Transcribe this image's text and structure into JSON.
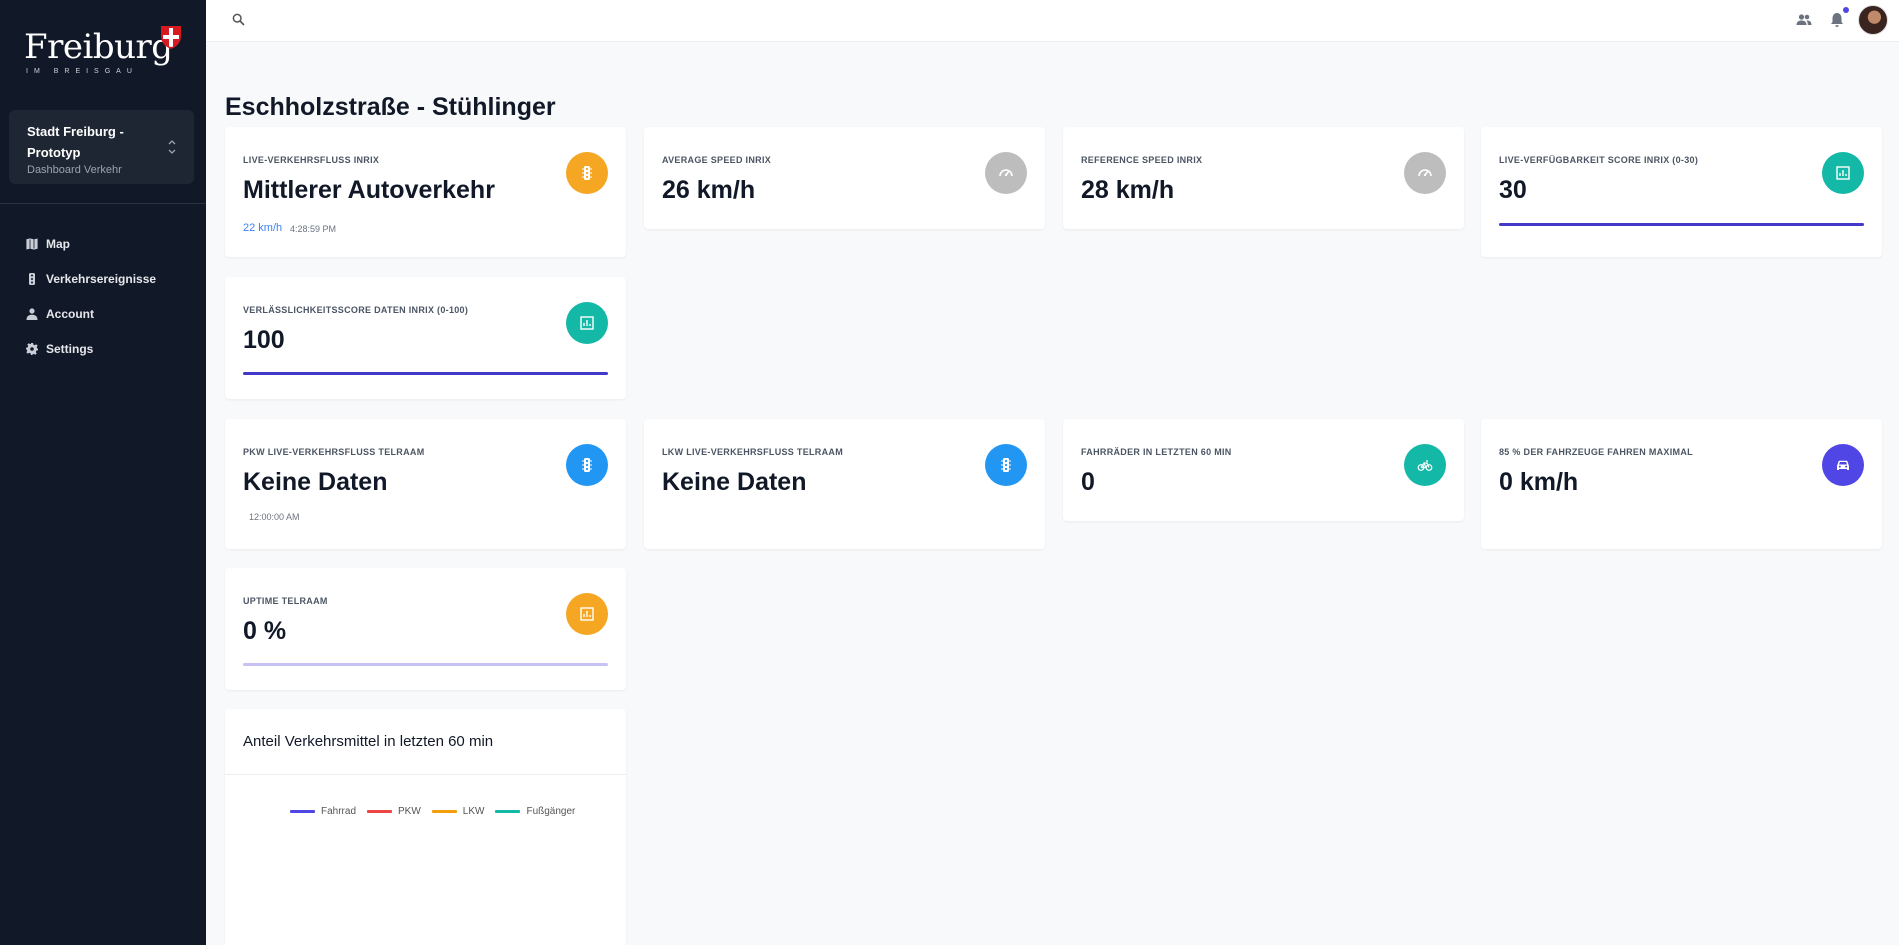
{
  "brand": {
    "logo_name": "Freiburg",
    "logo_sub": "IM BREISGAU"
  },
  "org": {
    "name": "Stadt Freiburg - Prototyp",
    "subtitle": "Dashboard Verkehr"
  },
  "nav": [
    {
      "label": "Map",
      "icon": "map-icon"
    },
    {
      "label": "Verkehrsereignisse",
      "icon": "traffic-light-icon"
    },
    {
      "label": "Account",
      "icon": "person-icon"
    },
    {
      "label": "Settings",
      "icon": "gear-icon"
    }
  ],
  "page": {
    "title": "Eschholzstraße - Stühlinger"
  },
  "cards": {
    "live_flow": {
      "label": "LIVE-VERKEHRSFLUSS INRIX",
      "value": "Mittlerer Autoverkehr",
      "speed": "22 km/h",
      "time": "4:28:59 PM",
      "icon": "traffic-light-icon",
      "color": "#f5a623"
    },
    "avg_speed": {
      "label": "AVERAGE SPEED INRIX",
      "value": "26 km/h",
      "icon": "speedometer-icon",
      "color": "#bdbdbd"
    },
    "ref_speed": {
      "label": "REFERENCE SPEED INRIX",
      "value": "28 km/h",
      "icon": "speedometer-icon",
      "color": "#bdbdbd"
    },
    "availability": {
      "label": "LIVE-VERFÜGBARKEIT SCORE INRIX (0-30)",
      "value": "30",
      "icon": "bar-chart-icon",
      "color": "#14b8a6"
    },
    "reliability": {
      "label": "VERLÄSSLICHKEITSSCORE DATEN INRIX (0-100)",
      "value": "100",
      "icon": "bar-chart-icon",
      "color": "#14b8a6"
    },
    "pkw": {
      "label": "PKW LIVE-VERKEHRSFLUSS TELRAAM",
      "value": "Keine Daten",
      "time": "12:00:00 AM",
      "icon": "traffic-light-icon",
      "color": "#2196f3"
    },
    "lkw": {
      "label": "LKW LIVE-VERKEHRSFLUSS TELRAAM",
      "value": "Keine Daten",
      "icon": "traffic-light-icon",
      "color": "#2196f3"
    },
    "bikes": {
      "label": "FAHRRÄDER IN LETZTEN 60 MIN",
      "value": "0",
      "icon": "bicycle-icon",
      "color": "#14b8a6"
    },
    "v85": {
      "label": "85 % DER FAHRZEUGE FAHREN MAXIMAL",
      "value": "0 km/h",
      "icon": "car-icon",
      "color": "#4f46e5"
    },
    "uptime": {
      "label": "UPTIME TELRAAM",
      "value": "0 %",
      "icon": "bar-chart-icon",
      "color": "#f5a623"
    }
  },
  "progress": {
    "availability_fraction": 1.0,
    "reliability_fraction": 1.0,
    "uptime_fraction": 0.0
  },
  "chart_data": {
    "type": "line",
    "title": "Anteil Verkehrsmittel in letzten 60 min",
    "series": [
      {
        "name": "Fahrrad",
        "color": "#4f46e5",
        "values": []
      },
      {
        "name": "PKW",
        "color": "#ef4444",
        "values": []
      },
      {
        "name": "LKW",
        "color": "#f59e0b",
        "values": []
      },
      {
        "name": "Fußgänger",
        "color": "#14b8a6",
        "values": []
      }
    ],
    "legend_position": "top"
  }
}
